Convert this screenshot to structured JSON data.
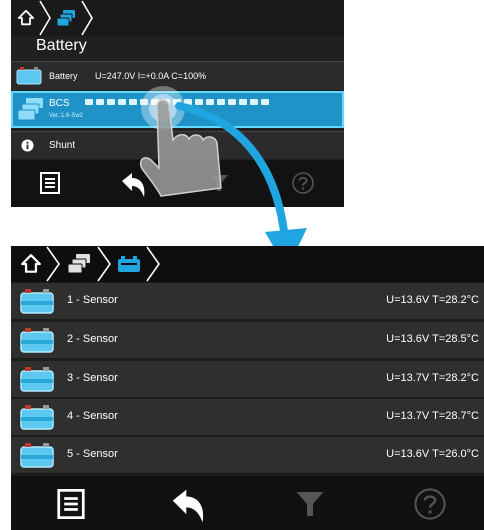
{
  "top_panel": {
    "title": "Battery",
    "rows": {
      "battery": {
        "label": "Battery",
        "values": "U=247.0V   I=+0.0A   C=100%"
      },
      "bcs": {
        "label": "BCS",
        "sub": "Ver.:1.6-Sw2"
      },
      "shunt": {
        "label": "Shunt"
      }
    }
  },
  "sensors": [
    {
      "name": "1 - Sensor",
      "values": "U=13.6V  T=28.2°C"
    },
    {
      "name": "2 - Sensor",
      "values": "U=13.6V  T=28.5°C"
    },
    {
      "name": "3 - Sensor",
      "values": "U=13.7V  T=28.2°C"
    },
    {
      "name": "4 - Sensor",
      "values": "U=13.7V  T=28.7°C"
    },
    {
      "name": "5 - Sensor",
      "values": "U=13.6V  T=26.0°C"
    }
  ],
  "colors": {
    "accent": "#1fa5df",
    "selection": "#1f93c8"
  },
  "icons": [
    "home-icon",
    "battery-stack-icon",
    "battery-icon",
    "list-icon",
    "back-icon",
    "filter-icon",
    "help-icon",
    "info-icon",
    "tap-gesture-icon",
    "curved-arrow-icon"
  ]
}
